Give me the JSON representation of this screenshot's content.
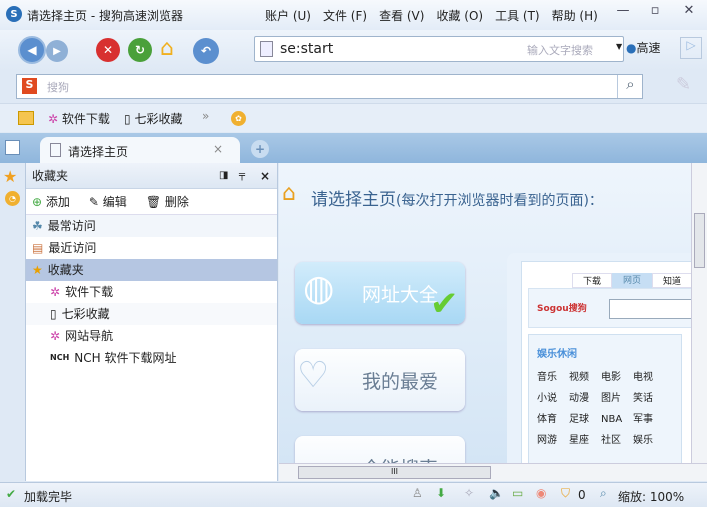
{
  "window": {
    "title": "请选择主页 - 搜狗高速浏览器",
    "menu": [
      "账户 (U)",
      "文件 (F)",
      "查看 (V)",
      "收藏 (O)",
      "工具 (T)",
      "帮助 (H)"
    ],
    "controls": [
      "—",
      "▫",
      "✕"
    ]
  },
  "nav": {
    "url": "se:start",
    "search_placeholder": "输入文字搜索",
    "speed_label": "高速"
  },
  "searchbar": {
    "placeholder": "搜狗"
  },
  "bookmarks": {
    "items": [
      "软件下载",
      "七彩收藏"
    ],
    "more": "»"
  },
  "tab": {
    "title": "请选择主页"
  },
  "sidebar": {
    "title": "收藏夹",
    "actions": [
      "添加",
      "编辑",
      "删除"
    ],
    "items": [
      "最常访问",
      "最近访问",
      "收藏夹"
    ],
    "children": [
      "软件下载",
      "七彩收藏",
      "网站导航",
      "NCH 软件下载网址"
    ]
  },
  "content": {
    "heading": "请选择主页",
    "heading_sub": "(每次打开浏览器时看到的页面)：",
    "cards": [
      "网址大全",
      "我的最爱",
      "全能搜索"
    ],
    "preview": {
      "tabs": [
        "下载",
        "网页",
        "知道"
      ],
      "category": "娱乐休闲",
      "links": [
        "音乐",
        "视频",
        "电影",
        "电视",
        "小说",
        "动漫",
        "图片",
        "笑话",
        "体育",
        "足球",
        "NBA",
        "军事",
        "网游",
        "星座",
        "社区",
        "娱乐"
      ],
      "logo": "Sogou搜狗"
    }
  },
  "status": {
    "text": "加载完毕",
    "count": "0",
    "zoom": "缩放: 100%"
  }
}
